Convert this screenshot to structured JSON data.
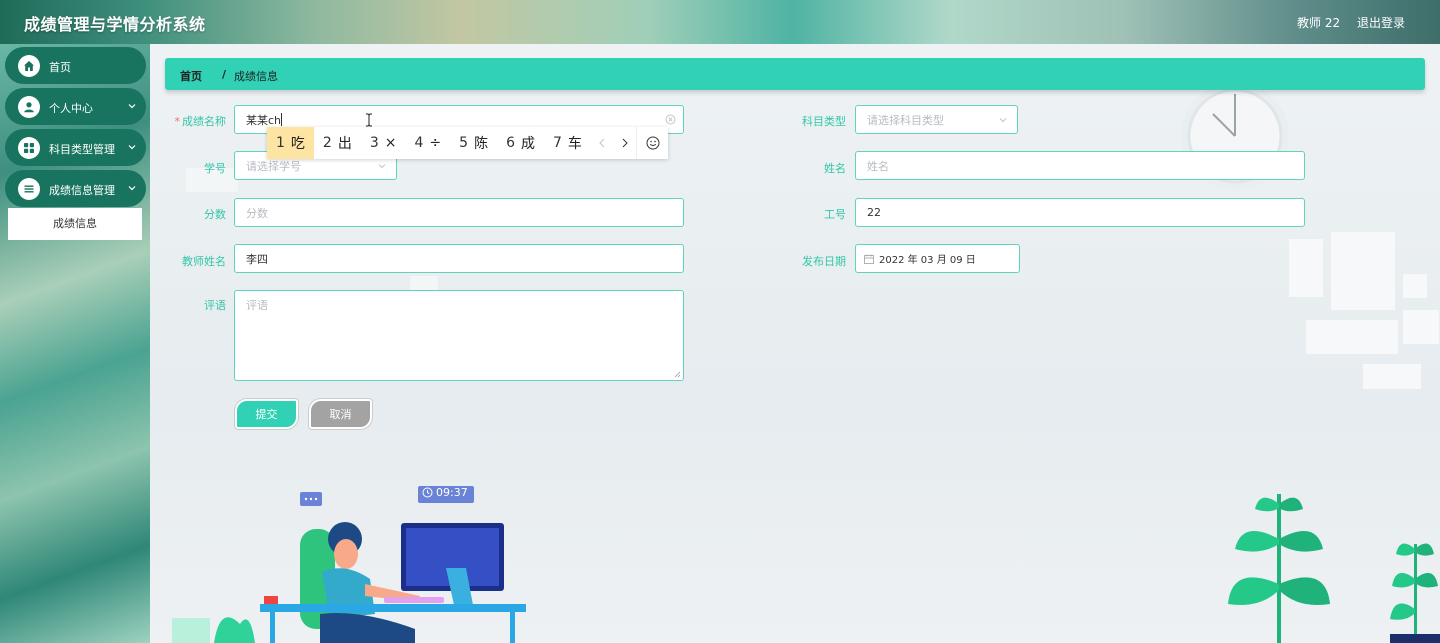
{
  "header": {
    "title": "成绩管理与学情分析系统",
    "user": "教师 22",
    "logout": "退出登录"
  },
  "sidebar": {
    "items": [
      {
        "label": "首页",
        "icon": "home-icon"
      },
      {
        "label": "个人中心",
        "icon": "user-icon"
      },
      {
        "label": "科目类型管理",
        "icon": "grid-icon"
      },
      {
        "label": "成绩信息管理",
        "icon": "list-icon"
      }
    ],
    "sub_item": "成绩信息"
  },
  "breadcrumb": {
    "home": "首页",
    "sep": "/",
    "current": "成绩信息"
  },
  "form": {
    "name_label": "成绩名称",
    "name_value": "某某ch",
    "subject_label": "科目类型",
    "subject_placeholder": "请选择科目类型",
    "student_id_label": "学号",
    "student_id_placeholder": "请选择学号",
    "student_name_label": "姓名",
    "student_name_placeholder": "姓名",
    "score_label": "分数",
    "score_placeholder": "分数",
    "work_id_label": "工号",
    "work_id_value": "22",
    "teacher_label": "教师姓名",
    "teacher_value": "李四",
    "date_label": "发布日期",
    "date_value": "2022 年 03 月 09 日",
    "comment_label": "评语",
    "comment_placeholder": "评语",
    "submit": "提交",
    "cancel": "取消"
  },
  "ime": {
    "candidates": [
      {
        "num": "1",
        "text": "吃"
      },
      {
        "num": "2",
        "text": "出"
      },
      {
        "num": "3",
        "text": "×"
      },
      {
        "num": "4",
        "text": "÷"
      },
      {
        "num": "5",
        "text": "陈"
      },
      {
        "num": "6",
        "text": "成"
      },
      {
        "num": "7",
        "text": "车"
      }
    ]
  },
  "illustration": {
    "clock_time": "09:37"
  },
  "colors": {
    "accent": "#30d1b5",
    "sidebar_item": "#19745f",
    "label": "#33c6a8"
  }
}
